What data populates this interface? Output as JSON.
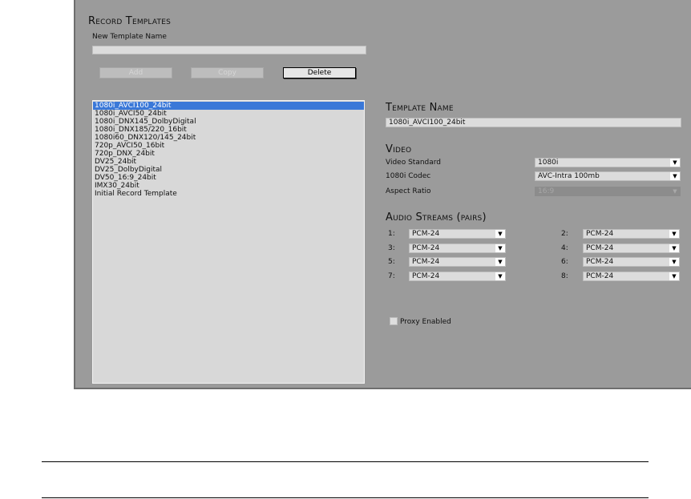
{
  "record_templates": {
    "title": "Record Templates",
    "new_name_label": "New Template Name",
    "new_name_value": "",
    "buttons": {
      "add": "Add",
      "copy": "Copy",
      "delete": "Delete"
    },
    "templates": [
      "1080i_AVCI100_24bit",
      "1080i_AVCI50_24bit",
      "1080i_DNX145_DolbyDigital",
      "1080i_DNX185/220_16bit",
      "1080i60_DNX120/145_24bit",
      "720p_AVCI50_16bit",
      "720p_DNX_24bit",
      "DV25_24bit",
      "DV25_DolbyDigital",
      "DV50_16:9_24bit",
      "IMX30_24bit",
      "Initial Record Template"
    ]
  },
  "template_name": {
    "title": "Template Name",
    "value": "1080i_AVCI100_24bit"
  },
  "video": {
    "title": "Video",
    "standard_label": "Video Standard",
    "standard_value": "1080i",
    "codec_label": "1080i Codec",
    "codec_value": "AVC-Intra 100mb",
    "aspect_label": "Aspect Ratio",
    "aspect_value": "16:9"
  },
  "audio": {
    "title": "Audio Streams (pairs)",
    "streams": [
      {
        "num": "1:",
        "value": "PCM-24"
      },
      {
        "num": "2:",
        "value": "PCM-24"
      },
      {
        "num": "3:",
        "value": "PCM-24"
      },
      {
        "num": "4:",
        "value": "PCM-24"
      },
      {
        "num": "5:",
        "value": "PCM-24"
      },
      {
        "num": "6:",
        "value": "PCM-24"
      },
      {
        "num": "7:",
        "value": "PCM-24"
      },
      {
        "num": "8:",
        "value": "PCM-24"
      }
    ]
  },
  "proxy": {
    "label": "Proxy Enabled",
    "checked": false
  },
  "icons": {
    "dropdown": "chevron-down-icon"
  },
  "colors": {
    "panel": "#9b9b9b",
    "selection": "#3a78d8"
  }
}
